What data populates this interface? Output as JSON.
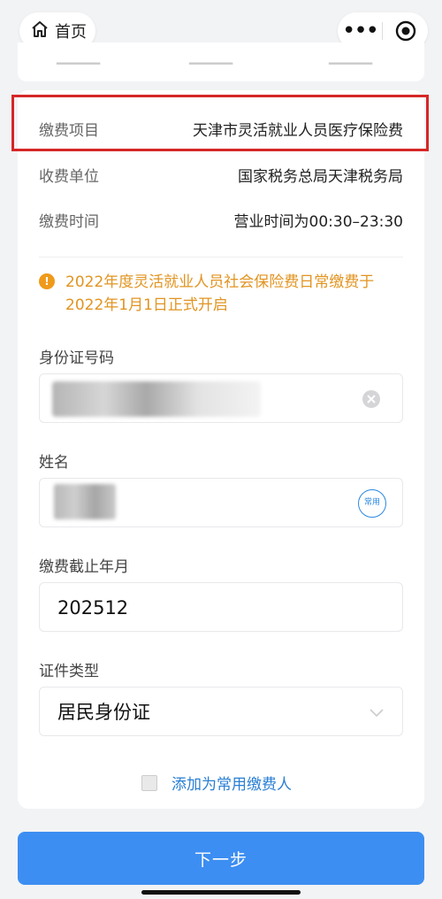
{
  "nav": {
    "home_label": "首页"
  },
  "info": [
    {
      "key": "缴费项目",
      "value": "天津市灵活就业人员医疗保险费"
    },
    {
      "key": "收费单位",
      "value": "国家税务总局天津税务局"
    },
    {
      "key": "缴费时间",
      "value": "营业时间为00:30–23:30"
    }
  ],
  "notice": {
    "line1": "2022年度灵活就业人员社会保险费日常缴费于",
    "line2": "2022年1月1日正式开启"
  },
  "form": {
    "id_label": "身份证号码",
    "name_label": "姓名",
    "frequent_badge": "常用",
    "deadline_label": "缴费截止年月",
    "deadline_value": "202512",
    "cert_label": "证件类型",
    "cert_value": "居民身份证"
  },
  "add_payer_label": "添加为常用缴费人",
  "next_button": "下一步",
  "colors": {
    "accent": "#3d8ef2",
    "notice": "#e29421",
    "highlight": "#d62626"
  }
}
